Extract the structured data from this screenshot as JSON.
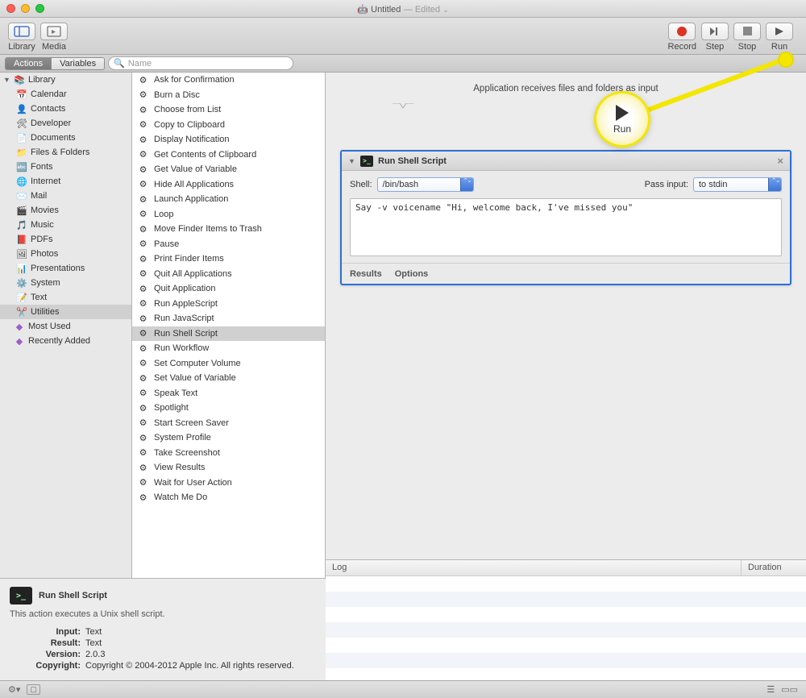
{
  "window": {
    "title": "Untitled",
    "status": "— Edited"
  },
  "toolbar": {
    "library": "Library",
    "media": "Media",
    "record": "Record",
    "step": "Step",
    "stop": "Stop",
    "run": "Run"
  },
  "secbar": {
    "actions": "Actions",
    "variables": "Variables",
    "search_placeholder": "Name"
  },
  "sidebar": {
    "root": "Library",
    "items": [
      "Calendar",
      "Contacts",
      "Developer",
      "Documents",
      "Files & Folders",
      "Fonts",
      "Internet",
      "Mail",
      "Movies",
      "Music",
      "PDFs",
      "Photos",
      "Presentations",
      "System",
      "Text",
      "Utilities"
    ],
    "selected": "Utilities",
    "extra": [
      "Most Used",
      "Recently Added"
    ]
  },
  "actions": {
    "items": [
      "Ask for Confirmation",
      "Burn a Disc",
      "Choose from List",
      "Copy to Clipboard",
      "Display Notification",
      "Get Contents of Clipboard",
      "Get Value of Variable",
      "Hide All Applications",
      "Launch Application",
      "Loop",
      "Move Finder Items to Trash",
      "Pause",
      "Print Finder Items",
      "Quit All Applications",
      "Quit Application",
      "Run AppleScript",
      "Run JavaScript",
      "Run Shell Script",
      "Run Workflow",
      "Set Computer Volume",
      "Set Value of Variable",
      "Speak Text",
      "Spotlight",
      "Start Screen Saver",
      "System Profile",
      "Take Screenshot",
      "View Results",
      "Wait for User Action",
      "Watch Me Do"
    ],
    "selected": "Run Shell Script"
  },
  "canvas": {
    "hint": "Application receives files and folders as input",
    "block": {
      "title": "Run Shell Script",
      "shell_label": "Shell:",
      "shell_value": "/bin/bash",
      "pass_label": "Pass input:",
      "pass_value": "to stdin",
      "script": "Say -v voicename \"Hi, welcome back, I've missed you\"",
      "results": "Results",
      "options": "Options"
    }
  },
  "info": {
    "title": "Run Shell Script",
    "desc": "This action executes a Unix shell script.",
    "rows": {
      "Input": "Text",
      "Result": "Text",
      "Version": "2.0.3",
      "Copyright": "Copyright © 2004-2012 Apple Inc.  All rights reserved."
    }
  },
  "log": {
    "col1": "Log",
    "col2": "Duration"
  },
  "callout": {
    "label": "Run"
  }
}
